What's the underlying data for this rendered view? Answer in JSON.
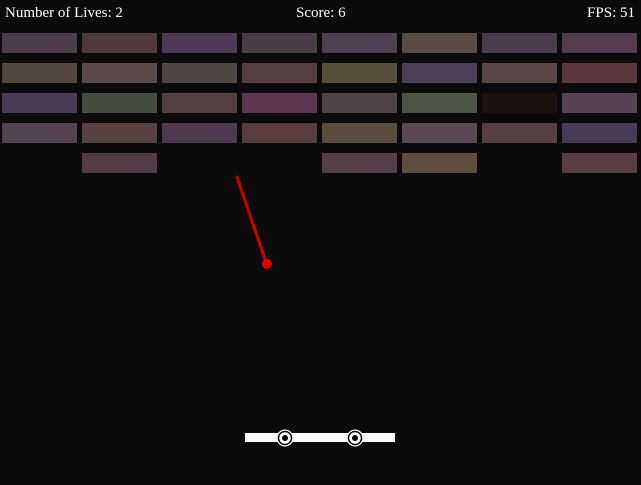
{
  "hud": {
    "lives_text": "Number of Lives: 2",
    "score_text": "Score: 6",
    "fps_text": "FPS: 51"
  },
  "colors": {
    "background": "#0b0b0b",
    "hud_text": "#ffffff",
    "ball": "#e00000",
    "ball_trail": "#cc0000",
    "paddle": "#ffffff",
    "paddle_eye_pupil": "#000000"
  },
  "bricks": {
    "columns": 8,
    "rows": [
      [
        "#4c3c4c",
        "#4e3a3e",
        "#4e3a54",
        "#4a3c44",
        "#4e4052",
        "#5a4a44",
        "#4a3c4c",
        "#533c50"
      ],
      [
        "#544640",
        "#5a4a4c",
        "#4c4644",
        "#543e44",
        "#56503a",
        "#4a3e58",
        "#584648",
        "#5a3840"
      ],
      [
        "#483c56",
        "#464c40",
        "#52403e",
        "#5a3650",
        "#4e4448",
        "#4e5446",
        "#1a1210",
        "#564454"
      ],
      [
        "#544450",
        "#56423e",
        "#4e3a4e",
        "#5a3c3c",
        "#5a4c3c",
        "#5a4852",
        "#584042",
        "#463c5a"
      ],
      [
        null,
        "#523c48",
        null,
        null,
        "#54404a",
        "#5e4e3c",
        null,
        "#5a3e46"
      ]
    ]
  },
  "paddle": {
    "eyes": 2
  }
}
